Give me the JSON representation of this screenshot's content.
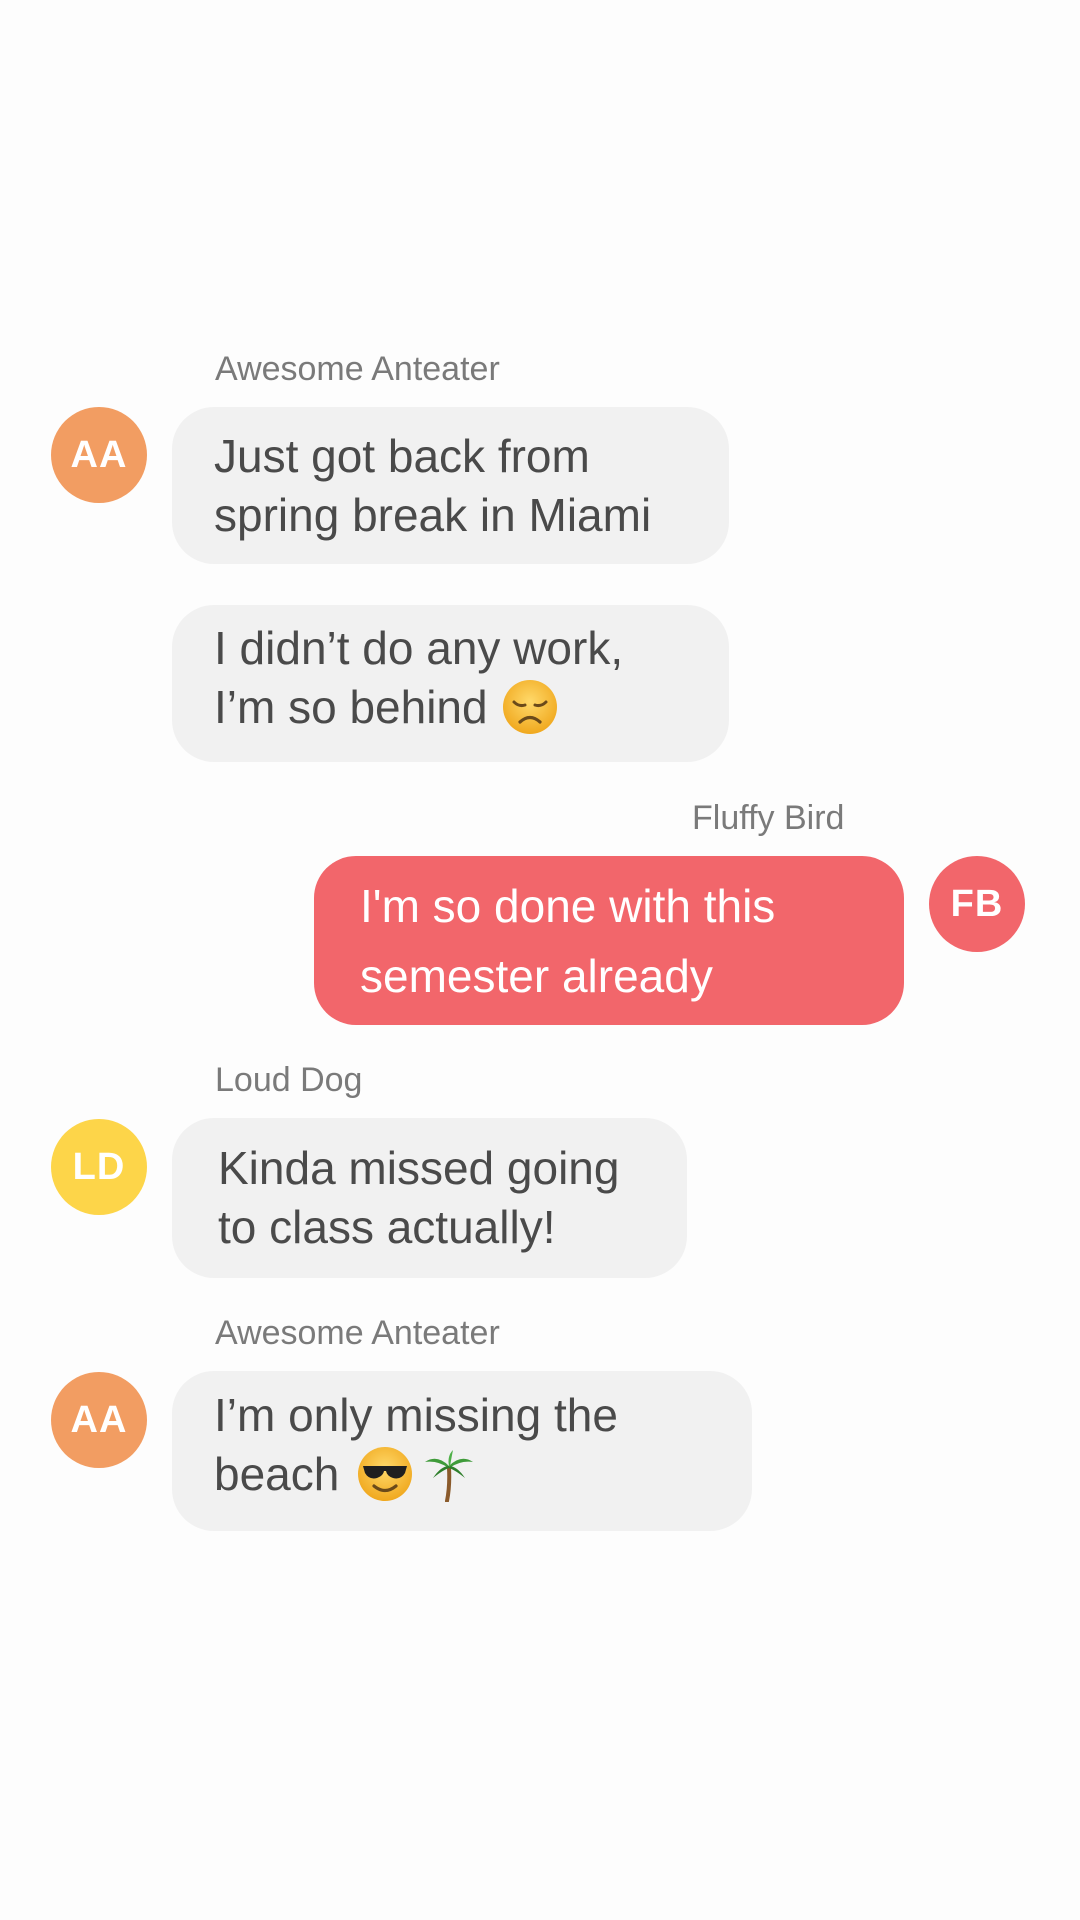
{
  "messages": [
    {
      "sender": "Awesome Anteater",
      "initials": "AA",
      "avatar_color": "#f29d62",
      "lines": [
        "Just got back from",
        "spring break in Miami"
      ],
      "emojis": []
    },
    {
      "sender": "",
      "initials": "",
      "avatar_color": "",
      "lines": [
        "I didn’t do any work,",
        "I’m so behind"
      ],
      "emojis": [
        "disappointed-face"
      ]
    },
    {
      "sender": "Fluffy Bird",
      "initials": "FB",
      "avatar_color": "#f2666b",
      "lines": [
        "I'm so done with this",
        "semester already"
      ],
      "emojis": [],
      "is_self": true
    },
    {
      "sender": "Loud Dog",
      "initials": "LD",
      "avatar_color": "#fdd549",
      "lines": [
        "Kinda missed going",
        "to class actually!"
      ],
      "emojis": []
    },
    {
      "sender": "Awesome Anteater",
      "initials": "AA",
      "avatar_color": "#f29d62",
      "lines": [
        "I’m only missing the",
        "beach"
      ],
      "emojis": [
        "smiling-face-with-sunglasses",
        "palm-tree"
      ]
    }
  ],
  "colors": {
    "incoming_bubble": "#f1f1f1",
    "outgoing_bubble": "#f2666b",
    "sender_name": "#7a7a7a",
    "message_text": "#4a4a4a"
  }
}
